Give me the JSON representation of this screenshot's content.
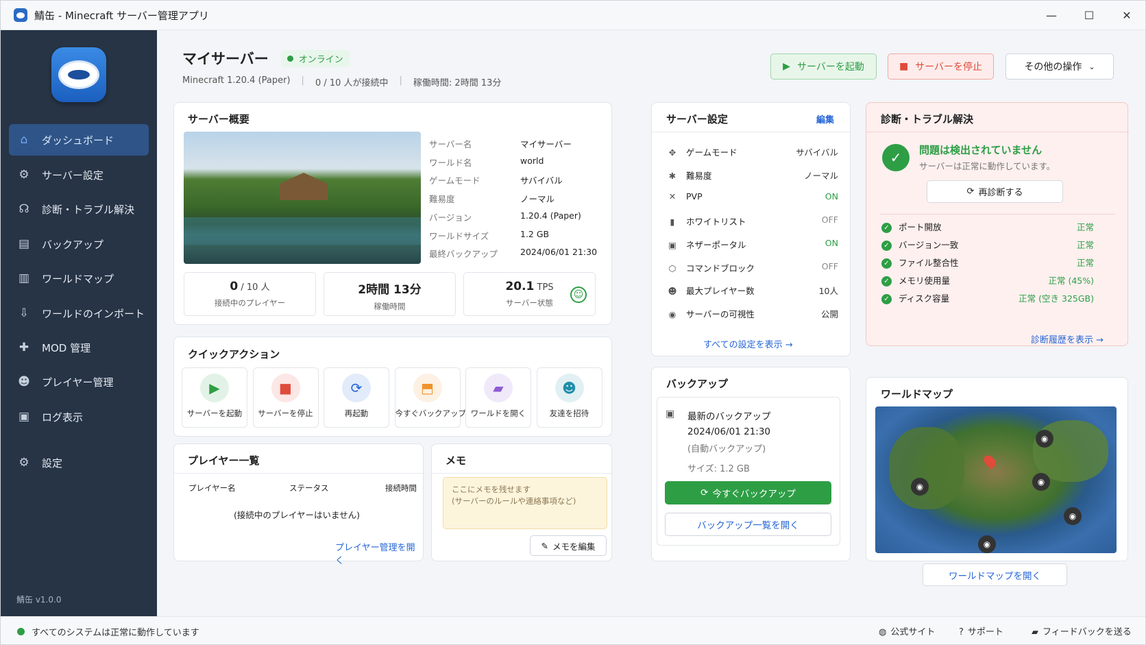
{
  "window": {
    "title": "鯖缶 - Minecraft サーバー管理アプリ"
  },
  "sidebar": {
    "items": [
      {
        "label": "ダッシュボード",
        "icon": "home-icon"
      },
      {
        "label": "サーバー設定",
        "icon": "gear-icon"
      },
      {
        "label": "診断・トラブル解決",
        "icon": "stethoscope-icon"
      },
      {
        "label": "バックアップ",
        "icon": "archive-icon"
      },
      {
        "label": "ワールドマップ",
        "icon": "map-icon"
      },
      {
        "label": "ワールドのインポート",
        "icon": "import-icon"
      },
      {
        "label": "MOD 管理",
        "icon": "puzzle-icon"
      },
      {
        "label": "プレイヤー管理",
        "icon": "users-icon"
      },
      {
        "label": "ログ表示",
        "icon": "document-icon"
      }
    ],
    "settings": "設定",
    "version": "鯖缶 v1.0.0"
  },
  "header": {
    "server_name": "マイサーバー",
    "status": "オンライン",
    "meta1": "Minecraft 1.20.4 (Paper)",
    "meta2": "0 / 10 人が接続中",
    "meta3": "稼働時間: 2時間 13分",
    "start": "サーバーを起動",
    "stop": "サーバーを停止",
    "more": "その他の操作"
  },
  "overview": {
    "title": "サーバー概要",
    "rows": [
      {
        "label": "サーバー名",
        "value": "マイサーバー"
      },
      {
        "label": "ワールド名",
        "value": "world"
      },
      {
        "label": "ゲームモード",
        "value": "サバイバル"
      },
      {
        "label": "難易度",
        "value": "ノーマル"
      },
      {
        "label": "バージョン",
        "value": "1.20.4 (Paper)"
      },
      {
        "label": "ワールドサイズ",
        "value": "1.2 GB"
      },
      {
        "label": "最終バックアップ",
        "value": "2024/06/01 21:30"
      }
    ],
    "stats": [
      {
        "big": "0",
        "small": " / 10 人",
        "label": "接続中のプレイヤー"
      },
      {
        "big": "2時間 13分",
        "small": "",
        "label": "稼働時間"
      },
      {
        "big": "20.1",
        "small": " TPS",
        "label": "サーバー状態"
      }
    ]
  },
  "quick": {
    "title": "クイックアクション",
    "items": [
      {
        "label": "サーバーを起動",
        "icon": "play-icon",
        "color": "#2e9e45"
      },
      {
        "label": "サーバーを停止",
        "icon": "stop-icon",
        "color": "#e04b3a"
      },
      {
        "label": "再起動",
        "icon": "refresh-icon",
        "color": "#2666d6"
      },
      {
        "label": "今すぐバックアップ",
        "icon": "backup-icon",
        "color": "#f0932b"
      },
      {
        "label": "ワールドを開く",
        "icon": "folder-icon",
        "color": "#8e5bd6"
      },
      {
        "label": "友達を招待",
        "icon": "invite-icon",
        "color": "#1f8fa8"
      }
    ]
  },
  "players": {
    "title": "プレイヤー一覧",
    "cols": [
      "プレイヤー名",
      "ステータス",
      "接続時間"
    ],
    "empty": "(接続中のプレイヤーはいません)",
    "link": "プレイヤー管理を開く"
  },
  "memo": {
    "title": "メモ",
    "placeholder": "ここにメモを残せます\n(サーバーのルールや連絡事項など)",
    "edit": "メモを編集"
  },
  "settings": {
    "title": "サーバー設定",
    "edit": "編集",
    "rows": [
      {
        "label": "ゲームモード",
        "value": "サバイバル",
        "icon": "gamepad-icon"
      },
      {
        "label": "難易度",
        "value": "ノーマル",
        "icon": "star-icon"
      },
      {
        "label": "PVP",
        "value": "ON",
        "icon": "swords-icon"
      },
      {
        "label": "ホワイトリスト",
        "value": "OFF",
        "icon": "clipboard-icon"
      },
      {
        "label": "ネザーポータル",
        "value": "ON",
        "icon": "portal-icon"
      },
      {
        "label": "コマンドブロック",
        "value": "OFF",
        "icon": "cube-icon"
      },
      {
        "label": "最大プレイヤー数",
        "value": "10人",
        "icon": "users-icon"
      },
      {
        "label": "サーバーの可視性",
        "value": "公開",
        "icon": "eye-icon"
      }
    ],
    "link": "すべての設定を表示"
  },
  "backup": {
    "title": "バックアップ",
    "latest": "最新のバックアップ",
    "date": "2024/06/01 21:30",
    "type": "(自動バックアップ)",
    "size": "サイズ: 1.2 GB",
    "now": "今すぐバックアップ",
    "list": "バックアップ一覧を開く"
  },
  "diag": {
    "title": "診断・トラブル解決",
    "ok_title": "問題は検出されていません",
    "ok_sub": "サーバーは正常に動作しています。",
    "rerun": "再診断する",
    "checks": [
      {
        "label": "ポート開放",
        "value": "正常"
      },
      {
        "label": "バージョン一致",
        "value": "正常"
      },
      {
        "label": "ファイル整合性",
        "value": "正常"
      },
      {
        "label": "メモリ使用量",
        "value": "正常 (45%)"
      },
      {
        "label": "ディスク容量",
        "value": "正常 (空き 325GB)"
      }
    ],
    "history": "診断履歴を表示"
  },
  "worldmap": {
    "title": "ワールドマップ",
    "open": "ワールドマップを開く"
  },
  "status": {
    "text": "すべてのシステムは正常に動作しています",
    "site": "公式サイト",
    "support": "サポート",
    "feedback": "フィードバックを送る"
  }
}
